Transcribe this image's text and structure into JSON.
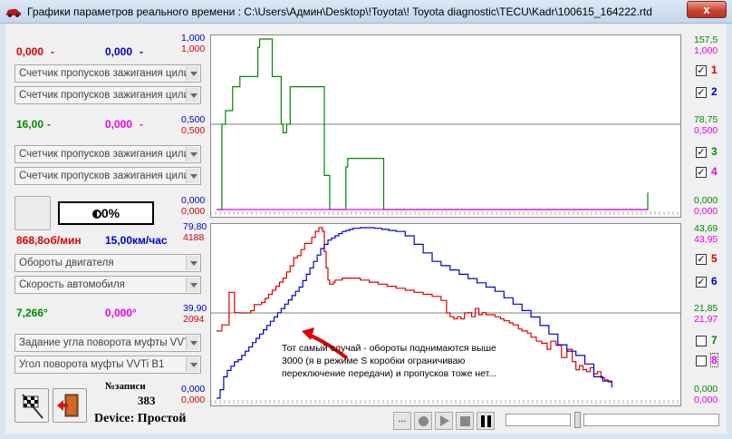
{
  "window": {
    "title": "Графики параметров реального времени : C:\\Users\\Админ\\Desktop\\!Toyota\\! Toyota diagnostic\\TECU\\Kadr\\100615_164222.rtd",
    "close_label": "x"
  },
  "left_panel": {
    "group1": {
      "val_red": "0,000",
      "val_blue": "0,000",
      "select1": "Счетчик пропусков зажигания цили",
      "select2": "Счетчик пропусков зажигания цили"
    },
    "group2": {
      "val_green": "16,00",
      "val_magenta": "0,000",
      "select1": "Счетчик пропусков зажигания цили",
      "select2": "Счетчик пропусков зажигания цили"
    },
    "percent": "0%",
    "group3": {
      "val_red": "868,8об/мин",
      "val_blue": "15,00км/час",
      "select1": "Обороты двигателя",
      "select2": "Скорость автомобиля"
    },
    "group4": {
      "val_green": "7,266°",
      "val_magenta": "0,000°",
      "select1": "Задание угла поворота муфты VVTi",
      "select2": "Угол поворота муфты VVTi B1"
    },
    "records_label": "№записи",
    "records_value": "383",
    "device": "Device: Простой"
  },
  "top_chart": {
    "left_axis": {
      "top_blue": "1,000",
      "top_red": "1,000",
      "mid_blue": "0,500",
      "mid_red": "0,500",
      "bot_blue": "0,000",
      "bot_red": "0,000"
    },
    "right_axis": {
      "top_green": "157,5",
      "top_magenta": "1,000",
      "mid_green": "78,75",
      "mid_magenta": "0,500",
      "bot_green": "0,000",
      "bot_magenta": "0,000"
    },
    "checkboxes": [
      {
        "label": "1",
        "checked": true,
        "color": "#dd0000"
      },
      {
        "label": "2",
        "checked": true,
        "color": "#0000cc"
      },
      {
        "label": "3",
        "checked": true,
        "color": "#008800"
      },
      {
        "label": "4",
        "checked": true,
        "color": "#ee00ee"
      }
    ]
  },
  "bottom_chart": {
    "left_axis": {
      "top_blue": "79,80",
      "top_red": "4188",
      "mid_blue": "39,90",
      "mid_red": "2094",
      "bot_blue": "0,000",
      "bot_red": "0,000"
    },
    "right_axis": {
      "top_green": "43,69",
      "top_magenta": "43,95",
      "mid_green": "21,85",
      "mid_magenta": "21,97",
      "bot_green": "0,000",
      "bot_magenta": "0,000"
    },
    "checkboxes": [
      {
        "label": "5",
        "checked": true,
        "color": "#dd0000"
      },
      {
        "label": "6",
        "checked": true,
        "color": "#0000cc"
      },
      {
        "label": "7",
        "checked": false,
        "color": "#008800"
      },
      {
        "label": "8",
        "checked": false,
        "color": "#ee00ee"
      }
    ],
    "annotation": "Тот самый случай - обороты поднимаются выше 3000 (я в режиме S коробки ограничиваю переключение передачи) и пропусков тоже нет..."
  },
  "playback": {
    "dots_label": "..."
  },
  "chart_data": [
    {
      "type": "line",
      "series": [
        {
          "color": "#008800",
          "x": [
            0,
            4,
            6,
            10,
            14,
            16,
            18,
            22,
            26,
            28,
            30,
            34,
            36,
            40,
            44,
            46,
            48,
            50,
            54,
            58,
            62,
            64,
            66,
            68,
            70,
            72,
            74,
            76,
            78,
            80,
            82,
            84,
            88,
            92,
            96,
            100,
            104,
            108,
            112,
            116,
            120,
            122,
            124,
            126,
            128,
            130,
            132,
            134,
            136,
            138,
            140,
            142,
            144,
            146,
            150,
            156,
            160,
            166,
            170,
            174,
            178,
            180,
            186,
            190,
            194,
            196,
            200,
            204,
            220,
            230,
            234,
            290,
            320,
            328,
            330,
            334,
            336,
            338,
            344,
            346,
            348,
            352,
            358,
            362,
            364,
            370,
            376,
            380,
            384,
            386,
            388,
            394,
            400,
            406,
            410,
            414,
            420,
            424,
            430,
            436,
            440,
            480
          ],
          "y": [
            0,
            0,
            0.5,
            0.58,
            0.58,
            0.58,
            0.72,
            0.72,
            0.78,
            0.78,
            0.78,
            0.78,
            0.78,
            0.78,
            0.78,
            0.95,
            1,
            1,
            1,
            1,
            0.78,
            0.78,
            0.78,
            0.78,
            0.78,
            0.5,
            0.45,
            0.45,
            0.5,
            0.5,
            0.72,
            0.72,
            0.72,
            0.72,
            0.72,
            0.72,
            0.72,
            0.72,
            0.72,
            0.72,
            0.2,
            0.2,
            0.2,
            0,
            0,
            0,
            0,
            0,
            0,
            0,
            0,
            0,
            0.25,
            0.3,
            0.3,
            0.3,
            0.3,
            0.3,
            0.3,
            0.3,
            0.3,
            0.3,
            0,
            0,
            0,
            0,
            0,
            0,
            0,
            0,
            0,
            0,
            0,
            0,
            0,
            0,
            0,
            0,
            0,
            0,
            0,
            0,
            0,
            0,
            0,
            0,
            0,
            0,
            0,
            0,
            0,
            0,
            0,
            0,
            0,
            0,
            0,
            0,
            0,
            0,
            0,
            0.1
          ]
        },
        {
          "color": "#ee00ee",
          "x": [
            0,
            480
          ],
          "y": [
            0,
            0
          ]
        }
      ]
    },
    {
      "type": "line",
      "series": [
        {
          "color": "#dd0000",
          "x": [
            0,
            4,
            6,
            10,
            14,
            16,
            18,
            20,
            24,
            26,
            28,
            30,
            34,
            38,
            42,
            46,
            50,
            54,
            58,
            62,
            66,
            70,
            74,
            78,
            82,
            86,
            90,
            94,
            98,
            102,
            106,
            110,
            114,
            118,
            120,
            122,
            124,
            126,
            128,
            130,
            132,
            134,
            136,
            138,
            140,
            146,
            154,
            160,
            170,
            180,
            190,
            200,
            210,
            220,
            230,
            240,
            250,
            256,
            260,
            264,
            268,
            272,
            276,
            280,
            284,
            288,
            292,
            296,
            300,
            304,
            310,
            316,
            320,
            326,
            330,
            336,
            340,
            346,
            350,
            356,
            362,
            368,
            372,
            378,
            384,
            390,
            396,
            400,
            404,
            408,
            412,
            416,
            420,
            424,
            428,
            432,
            436,
            440
          ],
          "y": [
            1650,
            1650,
            1800,
            1800,
            2600,
            2600,
            2600,
            2100,
            2100,
            2094,
            2094,
            2094,
            2094,
            2150,
            2300,
            2300,
            2350,
            2450,
            2550,
            2650,
            2750,
            2850,
            2950,
            3100,
            3250,
            3450,
            3500,
            3650,
            3800,
            3800,
            3950,
            4100,
            4188,
            4100,
            3600,
            3200,
            2900,
            2800,
            2800,
            2850,
            2900,
            2900,
            2900,
            2900,
            2950,
            2950,
            2950,
            2900,
            2850,
            2800,
            2750,
            2700,
            2650,
            2600,
            2550,
            2500,
            2400,
            2094,
            2000,
            1950,
            2000,
            1950,
            2094,
            2100,
            2000,
            2200,
            2050,
            2100,
            2050,
            2050,
            2000,
            1950,
            1900,
            1850,
            1800,
            1700,
            1650,
            1600,
            1500,
            1400,
            1350,
            1200,
            1400,
            1300,
            1000,
            1200,
            900,
            700,
            800,
            700,
            650,
            750,
            600,
            650,
            500,
            450,
            400,
            380
          ]
        },
        {
          "color": "#0000cc",
          "x": [
            0,
            4,
            8,
            12,
            16,
            20,
            24,
            28,
            32,
            36,
            40,
            44,
            48,
            52,
            56,
            60,
            64,
            68,
            72,
            76,
            80,
            84,
            88,
            92,
            96,
            100,
            104,
            108,
            112,
            116,
            120,
            124,
            128,
            132,
            136,
            140,
            144,
            148,
            152,
            160,
            168,
            176,
            184,
            192,
            200,
            210,
            220,
            230,
            240,
            250,
            260,
            270,
            280,
            290,
            300,
            310,
            320,
            330,
            340,
            350,
            360,
            370,
            380,
            390,
            400,
            410,
            420,
            430,
            440
          ],
          "y": [
            0,
            4,
            10,
            13,
            15,
            17,
            18,
            20,
            22,
            24,
            26,
            28,
            30,
            32,
            34,
            36,
            38,
            40,
            42,
            44,
            46,
            48,
            50,
            52,
            55,
            58,
            61,
            64,
            67,
            70,
            72,
            74,
            75,
            76,
            77,
            78,
            78.5,
            79,
            79.5,
            79.8,
            79.8,
            79.5,
            79,
            78.5,
            78,
            76,
            72,
            68,
            64,
            62,
            60,
            58,
            56,
            54,
            52,
            50,
            47,
            44,
            41,
            38,
            34,
            30,
            25,
            22,
            20,
            16,
            10,
            8,
            5
          ]
        }
      ],
      "ylim_left_red": [
        0,
        4188
      ],
      "ylim_left_blue": [
        0,
        79.8
      ]
    }
  ]
}
